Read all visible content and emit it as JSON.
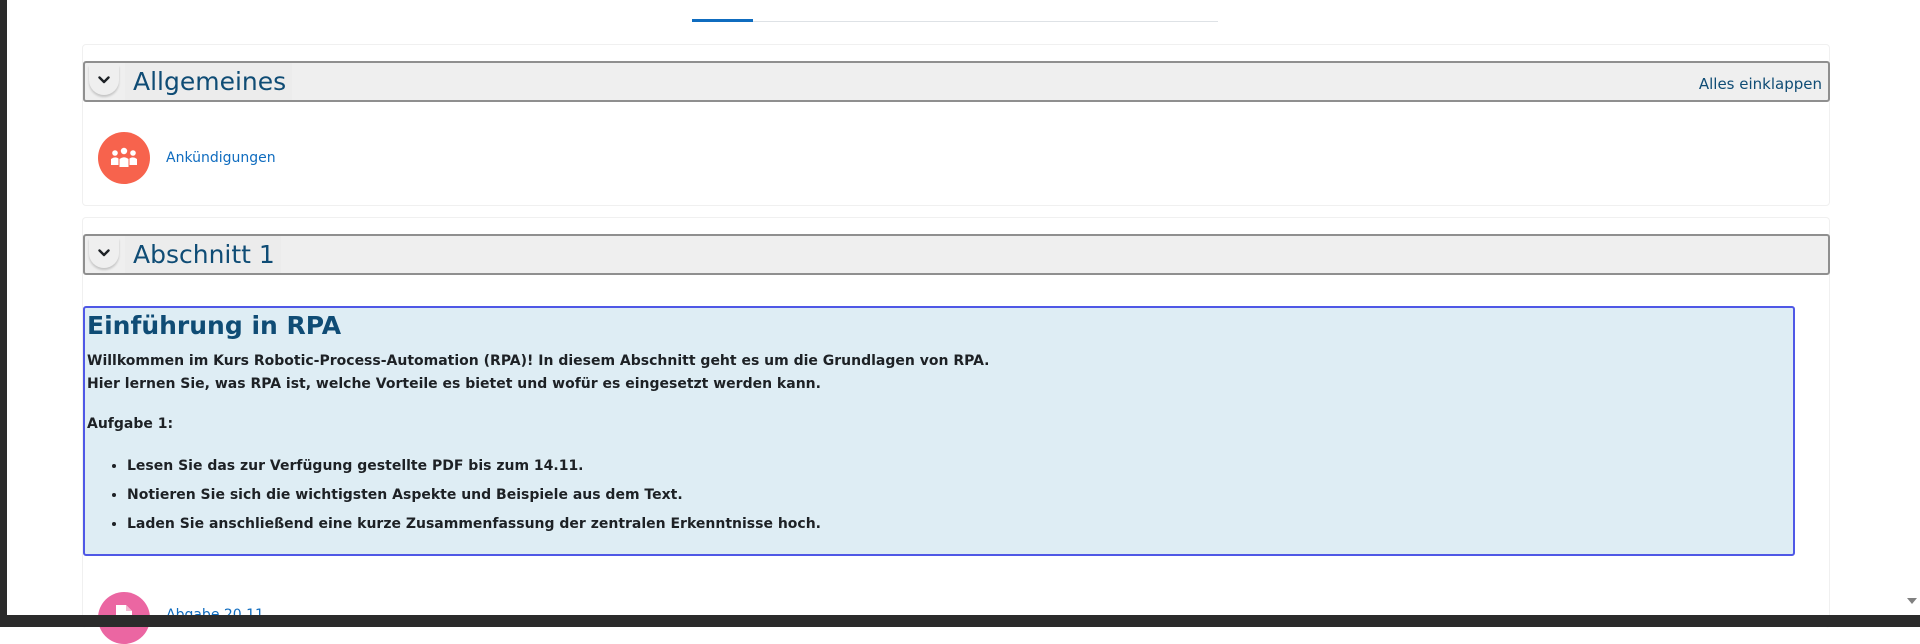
{
  "tabs": {
    "active_index": 0
  },
  "sections": [
    {
      "title": "Allgemeines",
      "collapse_all": "Alles einklappen",
      "activities": [
        {
          "name": "Ankündigungen",
          "icon": "forum-icon",
          "color": "#f7634d"
        }
      ]
    },
    {
      "title": "Abschnitt 1",
      "intro": {
        "heading": "Einführung in RPA",
        "line1": "Willkommen im Kurs Robotic-Process-Automation (RPA)! In diesem Abschnitt geht es um die Grundlagen von RPA.",
        "line2": "Hier lernen Sie, was RPA ist, welche Vorteile es bietet und wofür es eingesetzt werden kann.",
        "task_label": "Aufgabe 1:",
        "tasks": [
          "Lesen Sie das zur Verfügung gestellte PDF bis zum 14.11.",
          "Notieren Sie sich die wichtigsten Aspekte und Beispiele aus dem Text.",
          "Laden Sie anschließend eine kurze Zusammenfassung der zentralen Erkenntnisse hoch."
        ]
      },
      "activities": [
        {
          "name": "Abgabe 20.11.",
          "icon": "file-icon",
          "color": "#eb66a2"
        }
      ]
    }
  ],
  "colors": {
    "link": "#0f6cbf",
    "title": "#0f4c75",
    "intro_bg": "#deedf4",
    "intro_border": "#4f58e6"
  }
}
